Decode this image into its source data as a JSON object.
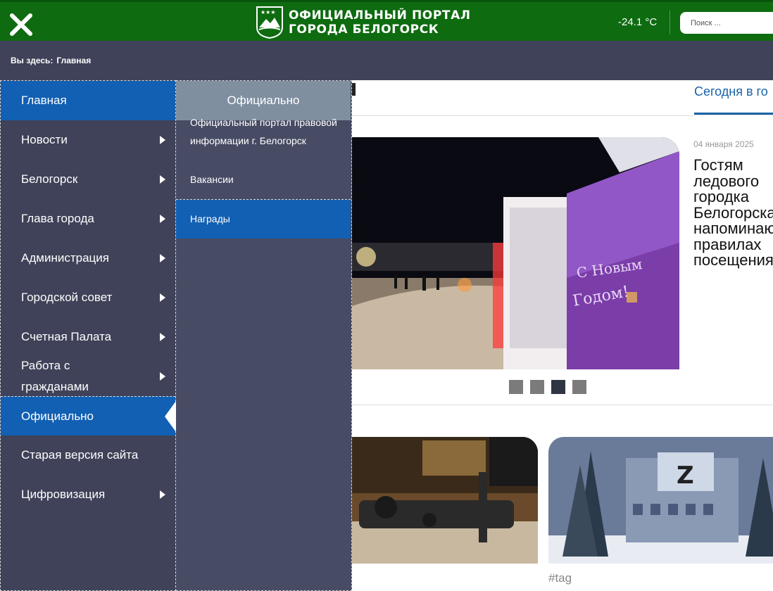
{
  "header": {
    "close_icon": "close-icon",
    "logo_line1": "ОФИЦИАЛЬНЫЙ ПОРТАЛ",
    "logo_line2": "ГОРОДА БЕЛОГОРСК",
    "temperature": "-24.1 °C",
    "search_placeholder": "Поиск ..."
  },
  "breadcrumb": {
    "prefix": "Вы здесь:",
    "current": "Главная"
  },
  "menu": {
    "items": [
      {
        "label": "Главная",
        "has_submenu": false,
        "state": "highlighted"
      },
      {
        "label": "Новости",
        "has_submenu": true
      },
      {
        "label": "Белогорск",
        "has_submenu": true
      },
      {
        "label": "Глава города",
        "has_submenu": true
      },
      {
        "label": "Администрация",
        "has_submenu": true
      },
      {
        "label": "Городской совет",
        "has_submenu": true
      },
      {
        "label": "Счетная Палата",
        "has_submenu": true
      },
      {
        "label": "Работа с гражданами",
        "has_submenu": true
      },
      {
        "label": "Официально",
        "has_submenu": true,
        "state": "open"
      },
      {
        "label": "Старая версия сайта",
        "has_submenu": false
      },
      {
        "label": "Цифровизация",
        "has_submenu": true
      }
    ]
  },
  "submenu": {
    "title": "Официально",
    "items": [
      {
        "label": "Официальный портал правовой информации г. Белогорск"
      },
      {
        "label": "Вакансии"
      },
      {
        "label": "Награды",
        "state": "active"
      }
    ]
  },
  "page": {
    "today_tab": "Сегодня в го",
    "news_date": "04 января 2025",
    "news_title": "Гостям ледового городка Белогорска напоминают о правилах посещения",
    "slider_pages": 4,
    "slider_active": 3,
    "tag": "#tag"
  },
  "colors": {
    "header_green": "#0e6b10",
    "menu_bg": "#3f4258",
    "menu_active": "#1260b3",
    "submenu_head": "#7f8fa0"
  }
}
